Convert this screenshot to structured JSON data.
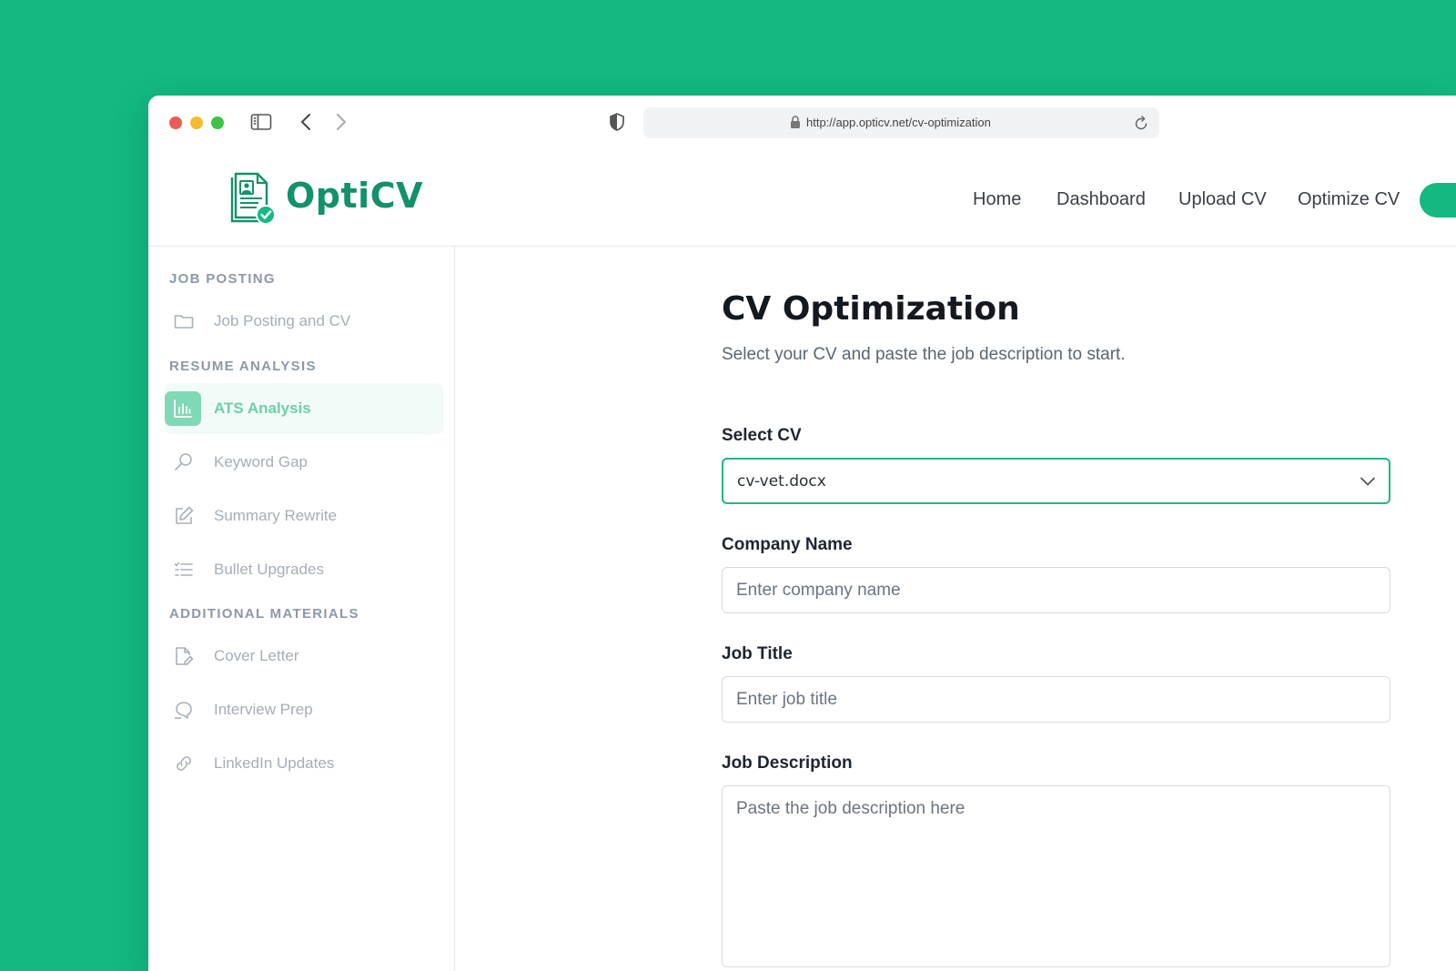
{
  "browser": {
    "url": "http://app.opticv.net/cv-optimization"
  },
  "brand": {
    "name": "OptiCV",
    "accent": "#13b981",
    "dark_accent": "#12916a"
  },
  "nav": {
    "items": [
      "Home",
      "Dashboard",
      "Upload CV",
      "Optimize CV"
    ]
  },
  "sidebar": {
    "sections": [
      {
        "title": "JOB POSTING",
        "items": [
          {
            "label": "Job Posting and CV",
            "icon": "folder-icon"
          }
        ]
      },
      {
        "title": "RESUME ANALYSIS",
        "items": [
          {
            "label": "ATS Analysis",
            "icon": "bar-chart-icon",
            "active": true
          },
          {
            "label": "Keyword Gap",
            "icon": "search-icon"
          },
          {
            "label": "Summary Rewrite",
            "icon": "edit-icon"
          },
          {
            "label": "Bullet Upgrades",
            "icon": "list-icon"
          }
        ]
      },
      {
        "title": "ADDITIONAL MATERIALS",
        "items": [
          {
            "label": "Cover Letter",
            "icon": "document-pen-icon"
          },
          {
            "label": "Interview Prep",
            "icon": "chat-icon"
          },
          {
            "label": "LinkedIn Updates",
            "icon": "link-icon"
          }
        ]
      }
    ]
  },
  "main": {
    "title": "CV Optimization",
    "subtitle": "Select your CV and paste the job description to start.",
    "select_cv": {
      "label": "Select CV",
      "value": "cv-vet.docx"
    },
    "company": {
      "label": "Company Name",
      "placeholder": "Enter company name"
    },
    "job_title": {
      "label": "Job Title",
      "placeholder": "Enter job title"
    },
    "job_description": {
      "label": "Job Description",
      "placeholder": "Paste the job description here"
    }
  }
}
